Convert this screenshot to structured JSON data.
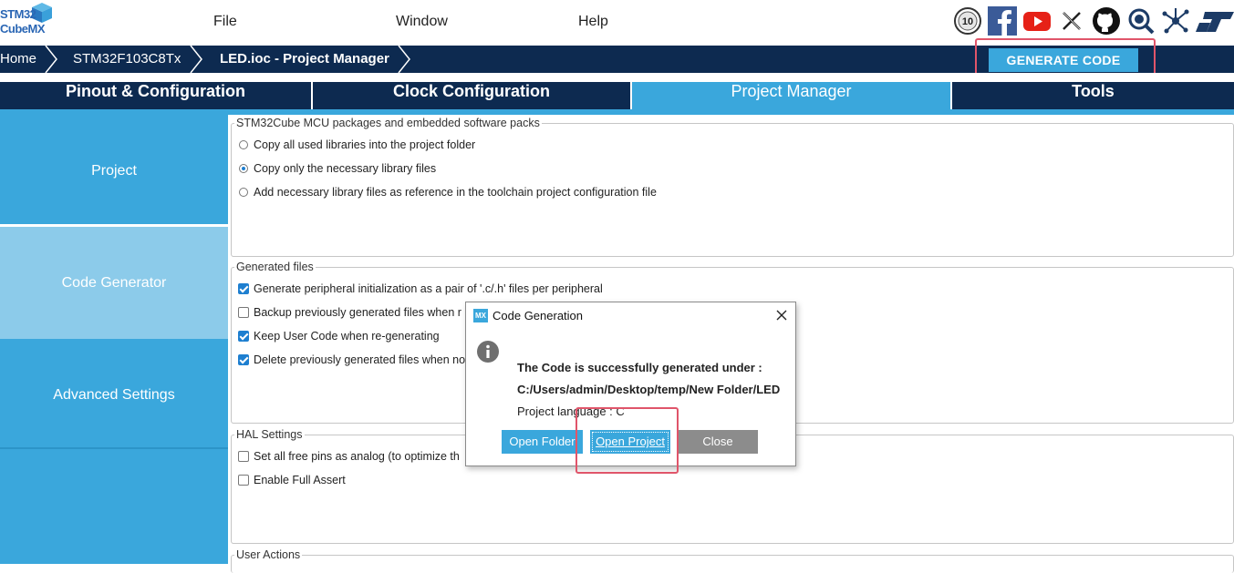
{
  "logo": {
    "line1": "STM32",
    "line2": "CubeMX"
  },
  "menu": {
    "items": [
      "File",
      "Window",
      "Help"
    ]
  },
  "social_icons": [
    "anniversary-10-icon",
    "facebook-icon",
    "youtube-icon",
    "x-icon",
    "github-icon",
    "community-icon",
    "network-icon",
    "st-logo-icon"
  ],
  "breadcrumb": {
    "items": [
      "Home",
      "STM32F103C8Tx",
      "LED.ioc - Project Manager"
    ]
  },
  "generate_button": "GENERATE CODE",
  "tabs": [
    {
      "label": "Pinout & Configuration",
      "active": false
    },
    {
      "label": "Clock Configuration",
      "active": false
    },
    {
      "label": "Project Manager",
      "active": true
    },
    {
      "label": "Tools",
      "active": false
    }
  ],
  "sidebar": {
    "items": [
      "Project",
      "Code Generator",
      "Advanced Settings"
    ],
    "selected": "Code Generator"
  },
  "packages": {
    "legend": "STM32Cube MCU packages and embedded software packs",
    "options": [
      {
        "label": "Copy all used libraries into the project folder",
        "selected": false
      },
      {
        "label": "Copy only the necessary library files",
        "selected": true
      },
      {
        "label": "Add necessary library files as reference in the toolchain project configuration file",
        "selected": false
      }
    ]
  },
  "generated_files": {
    "legend": "Generated files",
    "options": [
      {
        "label": "Generate peripheral initialization as a pair of '.c/.h' files per peripheral",
        "checked": true
      },
      {
        "label": "Backup previously generated files when r",
        "checked": false
      },
      {
        "label": "Keep User Code when re-generating",
        "checked": true
      },
      {
        "label": "Delete previously generated files when no",
        "checked": true
      }
    ]
  },
  "hal_settings": {
    "legend": "HAL Settings",
    "options": [
      {
        "label": "Set all free pins as analog (to optimize th",
        "checked": false
      },
      {
        "label": "Enable Full Assert",
        "checked": false
      }
    ]
  },
  "user_actions": {
    "legend": "User Actions"
  },
  "dialog": {
    "badge": "MX",
    "title": "Code Generation",
    "message_line1": "The Code is successfully generated under :",
    "message_line2": "C:/Users/admin/Desktop/temp/New Folder/LED",
    "message_line3": "Project language : C",
    "buttons": {
      "open_folder": "Open Folder",
      "open_project": "Open Project",
      "close": "Close"
    }
  },
  "colors": {
    "navy": "#0d2a50",
    "accent": "#3aa7dc",
    "selected": "#8ccbea",
    "highlight": "#e0556a"
  }
}
